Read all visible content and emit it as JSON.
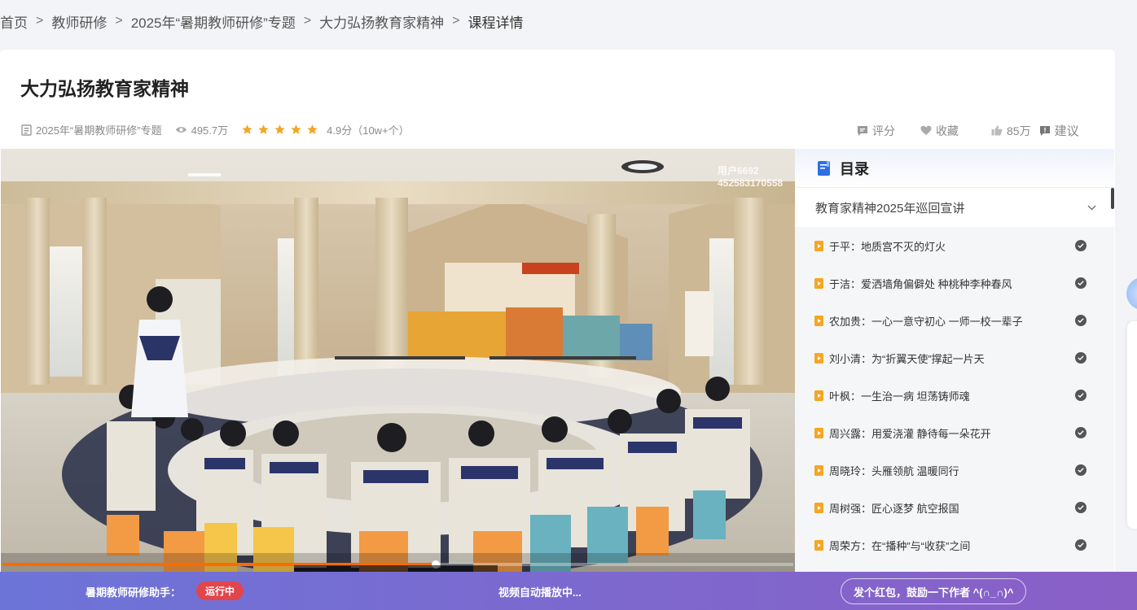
{
  "breadcrumb": {
    "items": [
      "首页",
      "教师研修",
      "2025年“暑期教师研修”专题",
      "大力弘扬教育家精神",
      "课程详情"
    ],
    "separator": ">"
  },
  "course": {
    "title": "大力弘扬教育家精神",
    "topic": "2025年“暑期教师研修”专题",
    "views": "495.7万",
    "rating": {
      "stars": 5,
      "score": "4.9分",
      "count": "（10w+个）"
    }
  },
  "actions": {
    "rate": "评分",
    "favorite": "收藏",
    "likes": "85万",
    "suggest": "建议"
  },
  "video": {
    "watermark_line1": "用户6692",
    "watermark_line2": "452583170558",
    "progress": 0.548
  },
  "catalog": {
    "heading": "目录",
    "chapter": "教育家精神2025年巡回宣讲",
    "lessons": [
      "于平：地质宫不灭的灯火",
      "于洁：爱洒墙角偏僻处 种桃种李种春风",
      "农加贵：一心一意守初心 一师一校一辈子",
      "刘小清：为“折翼天使”撑起一片天",
      "叶枫：一生治一病 坦荡铸师魂",
      "周兴露：用爱浇灌 静待每一朵花开",
      "周晓玲：头雁领航 温暖同行",
      "周树强：匠心逐梦 航空报国",
      "周荣方：在“播种”与“收获”之间"
    ]
  },
  "bottom_bar": {
    "assistant": "暑期教师研修助手：",
    "status": "运行中",
    "autoplay": "视频自动播放中...",
    "tip": "发个红包，鼓励一下作者 ^(∩_∩)^"
  },
  "colors": {
    "accent_orange": "#ff6a00",
    "lesson_icon": "#f5a623",
    "status_red": "#e2454c",
    "bar_gradient_start": "#6c74d8",
    "bar_gradient_end": "#8a5fc6",
    "star": "#f5a623"
  }
}
